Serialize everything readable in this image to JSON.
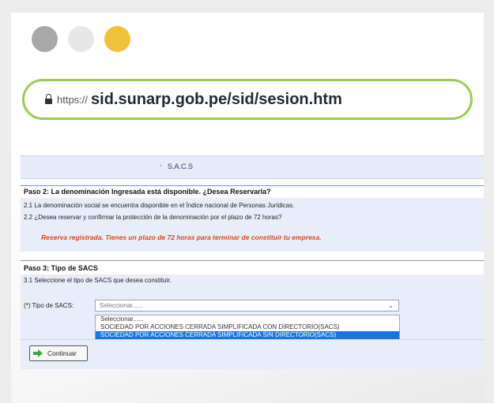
{
  "window": {
    "dots": [
      "close",
      "minimize",
      "maximize"
    ],
    "colors": {
      "gray": "#a8a8a8",
      "white": "#e7e7e7",
      "yellow": "#f0c23a",
      "urlbar_border": "#9ccc4e"
    }
  },
  "urlbar": {
    "protocol": "https://",
    "host": "sid.sunarp.gob.pe/sid/sesion.htm"
  },
  "page": {
    "title": "S.A.C.S",
    "step2": {
      "heading": "Paso 2: La denominación Ingresada está disponible. ¿Desea Reservarla?",
      "line1": "2.1 La denominación social se encuentra disponible en el Índice nacional de Personas Jurídicas.",
      "line2": "2.2 ¿Desea reservar y confirmar la protección de la denominación por el plazo de 72 horas?",
      "warning": "Reserva registrada. Tienes un plazo de 72 horas para terminar de constituir tu empresa."
    },
    "step3": {
      "heading": "Paso 3: Tipo de SACS",
      "line1": "3.1 Seleccione el tipo de SACS que desea constituir.",
      "select_label": "(*) Tipo de SACS:",
      "select_value": "Seleccionar......",
      "options": [
        "Seleccionar......",
        "SOCIEDAD POR ACCIONES CERRADA SIMPLIFICADA CON DIRECTORIO(SACS)",
        "SOCIEDAD POR ACCIONES CERRADA SIMPLIFICADA SIN DIRECTORIO(SACS)"
      ],
      "highlighted_option_index": 2
    },
    "continue_label": "Continuar"
  }
}
